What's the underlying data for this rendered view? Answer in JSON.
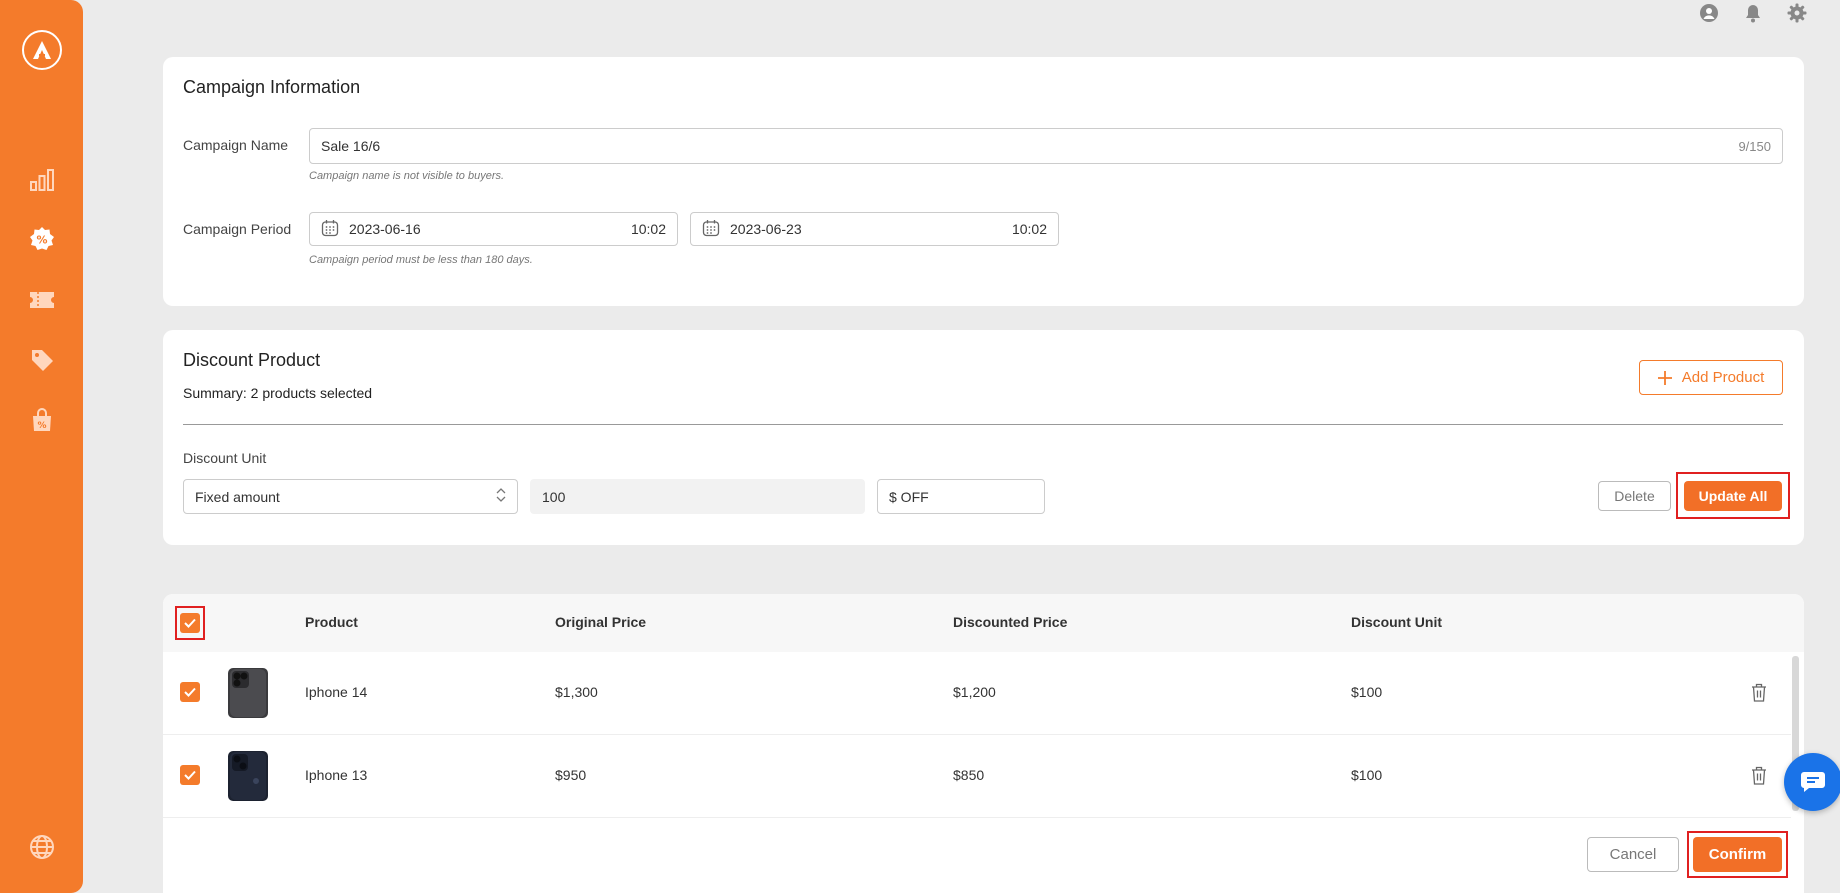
{
  "colors": {
    "brand": "#f47b2b",
    "button_primary": "#f26f27",
    "highlight": "#e02020",
    "chat": "#1a73e8"
  },
  "sidebar": {
    "logo": "a-logo-icon",
    "items": [
      {
        "icon": "chart-icon"
      },
      {
        "icon": "discount-badge-icon",
        "active": true
      },
      {
        "icon": "voucher-icon"
      },
      {
        "icon": "price-tag-icon"
      },
      {
        "icon": "shopping-bag-discount-icon"
      }
    ],
    "bottom_icon": "globe-icon"
  },
  "topbar": {
    "icons": [
      "user-icon",
      "bell-icon",
      "gear-icon"
    ]
  },
  "campaign": {
    "title": "Campaign Information",
    "name_label": "Campaign Name",
    "name_value": "Sale 16/6",
    "name_counter": "9/150",
    "name_hint": "Campaign name is not visible to buyers.",
    "period_label": "Campaign Period",
    "start_date": "2023-06-16",
    "start_time": "10:02",
    "end_date": "2023-06-23",
    "end_time": "10:02",
    "period_hint": "Campaign period must be less than 180 days."
  },
  "discount": {
    "title": "Discount Product",
    "summary": "Summary: 2 products selected",
    "add_label": "Add Product",
    "unit_label": "Discount Unit",
    "unit_select": "Fixed amount",
    "amount_value": "100",
    "suffix_value": "$ OFF",
    "delete_label": "Delete",
    "update_all_label": "Update All"
  },
  "table": {
    "headers": [
      "Product",
      "Original Price",
      "Discounted Price",
      "Discount Unit"
    ],
    "rows": [
      {
        "name": "Iphone 14",
        "original": "$1,300",
        "discounted": "$1,200",
        "unit": "$100",
        "checked": true
      },
      {
        "name": "Iphone 13",
        "original": "$950",
        "discounted": "$850",
        "unit": "$100",
        "checked": true
      }
    ],
    "cancel_label": "Cancel",
    "confirm_label": "Confirm"
  }
}
